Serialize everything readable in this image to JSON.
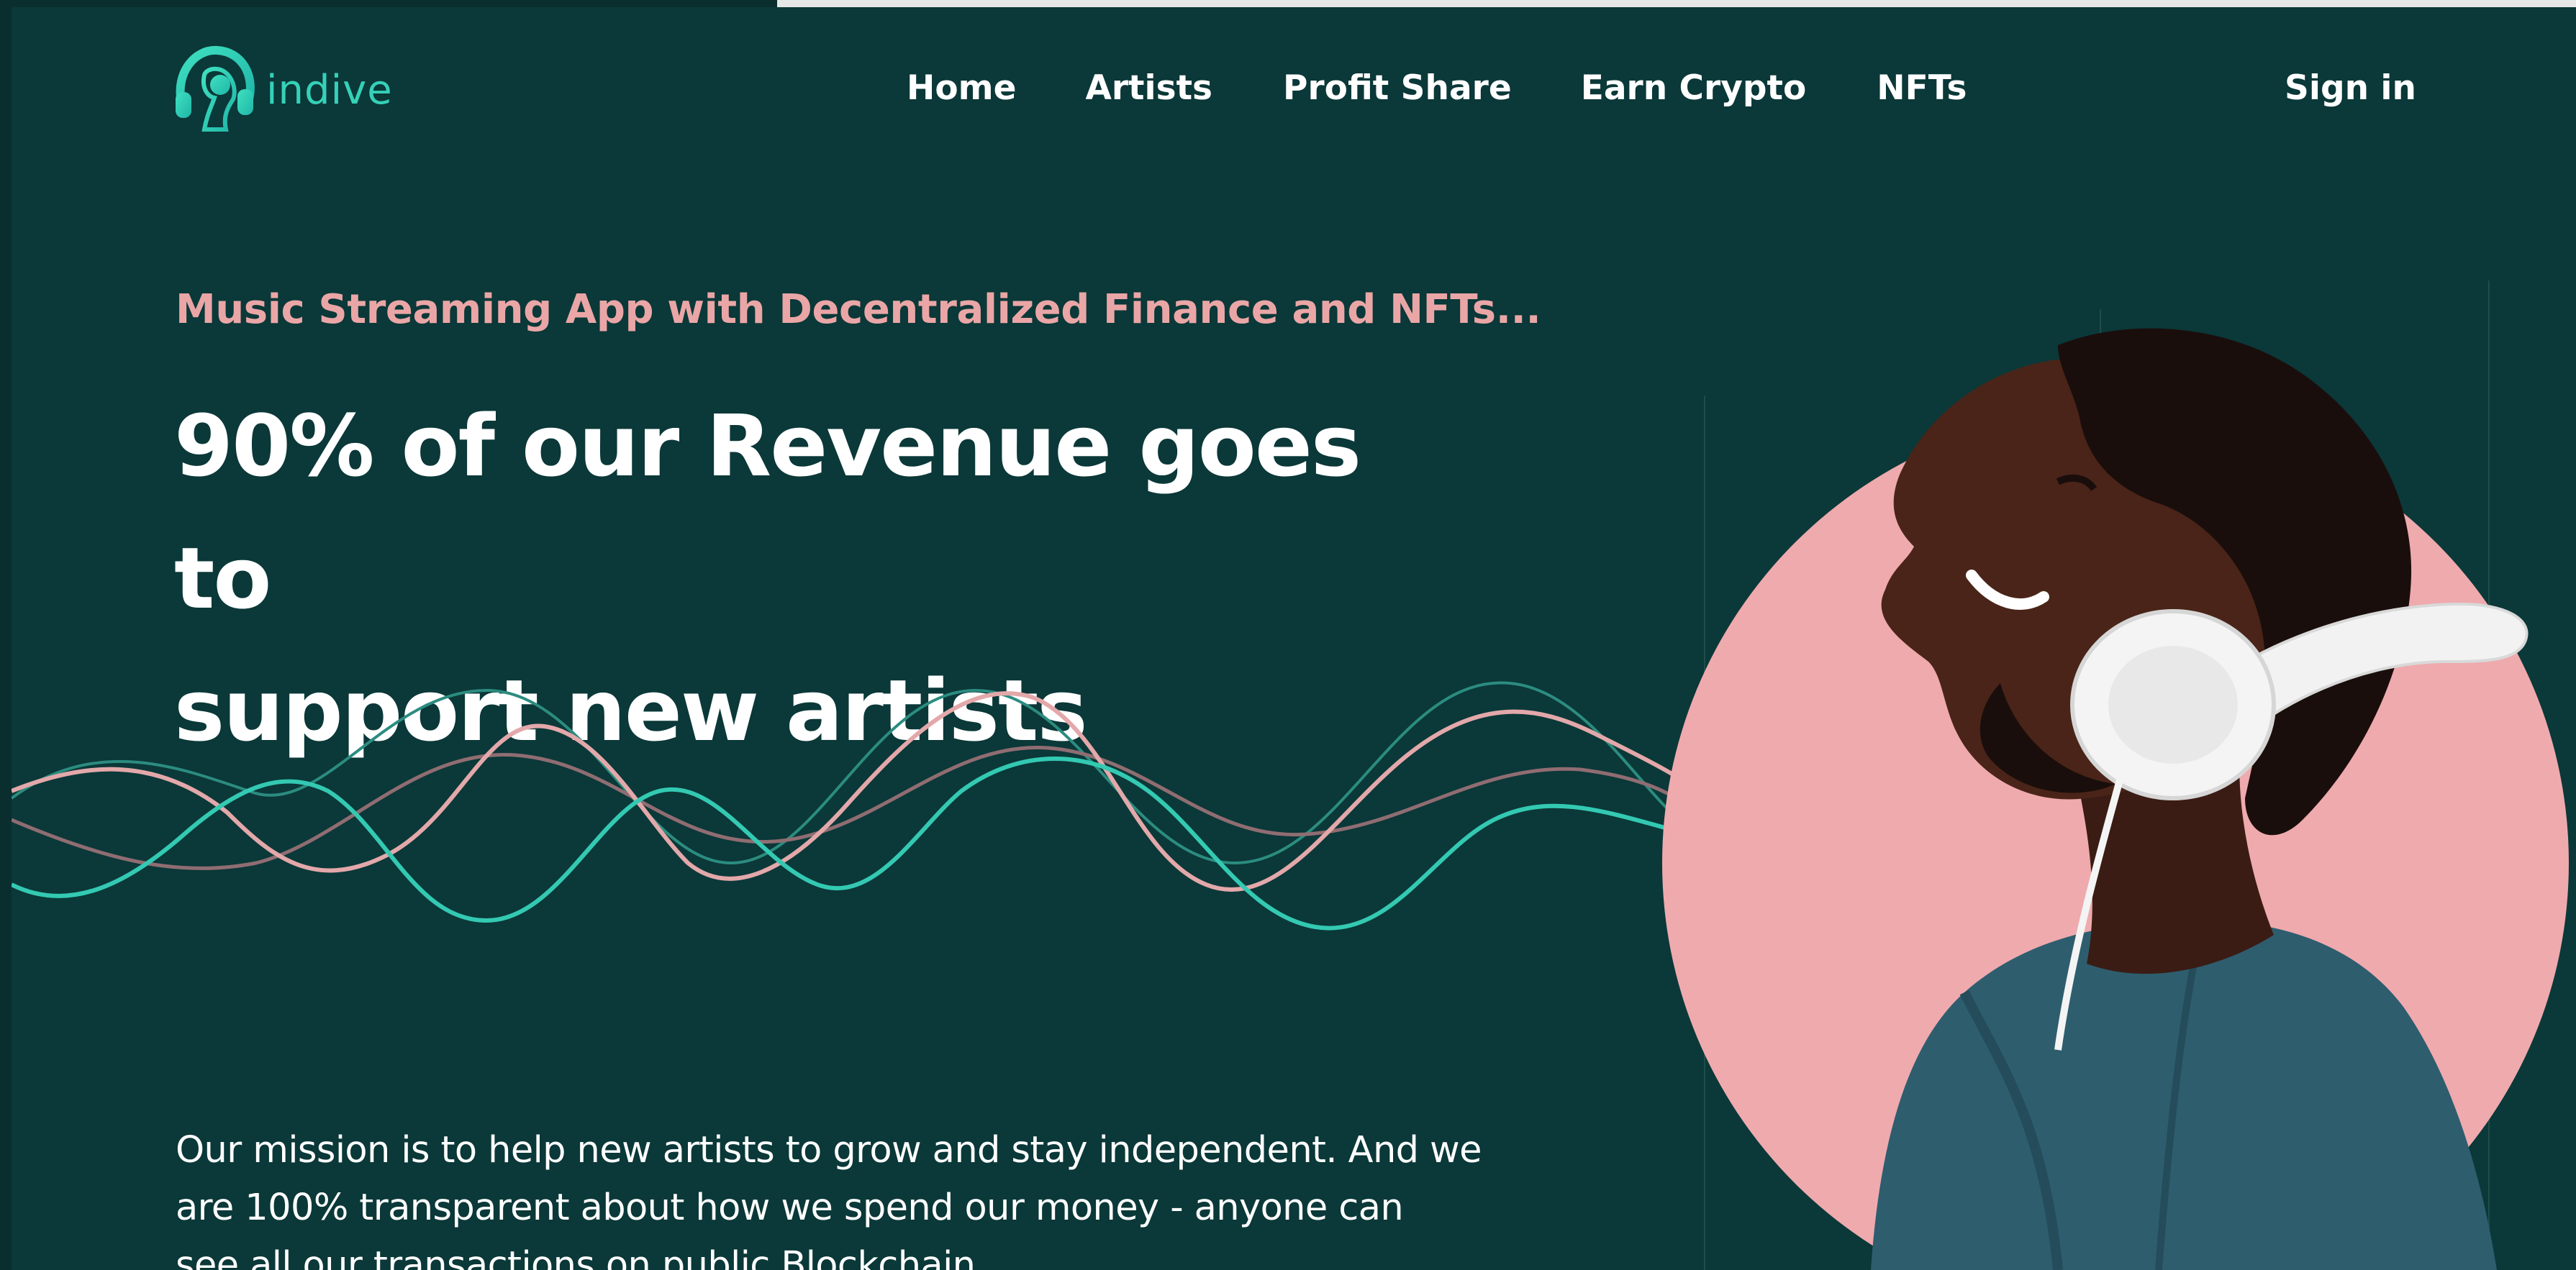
{
  "brand": {
    "name": "indive",
    "logo_icon": "headphones-person-logo"
  },
  "nav": {
    "items": [
      {
        "label": "Home"
      },
      {
        "label": "Artists"
      },
      {
        "label": "Profit Share"
      },
      {
        "label": "Earn Crypto"
      },
      {
        "label": "NFTs"
      }
    ],
    "signin_label": "Sign in"
  },
  "hero": {
    "tagline": "Music Streaming App with Decentralized Finance and NFTs...",
    "headline_line1": "90% of our Revenue goes to",
    "headline_line2": "support new artists",
    "mission_line1": "Our mission is to help new artists to grow and stay independent. And we",
    "mission_line2": "are 100% transparent about how we spend our money - anyone can",
    "mission_line3": "see all our transactions on public Blockchain"
  },
  "colors": {
    "background": "#0b3838",
    "accent_teal": "#35d1b8",
    "accent_pink": "#eaa6a6",
    "circle_pink": "#efaaae",
    "text": "#ffffff"
  }
}
